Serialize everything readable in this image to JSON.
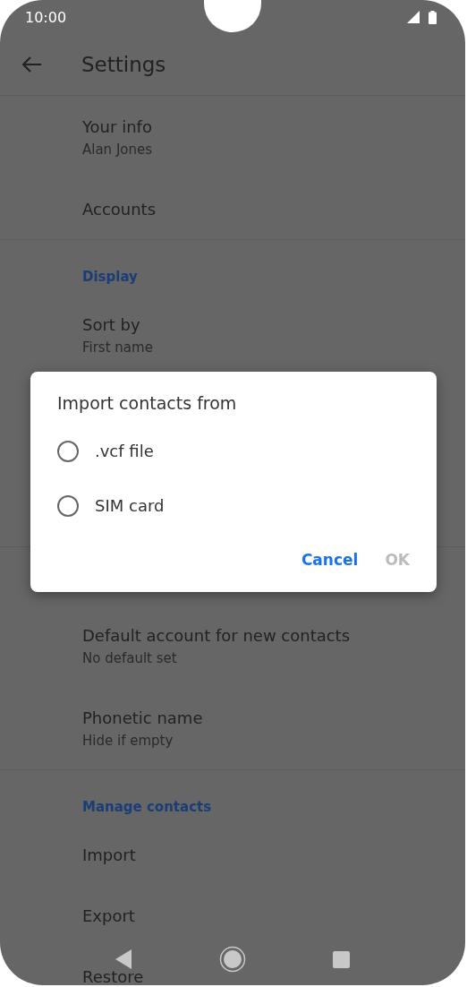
{
  "status_bar": {
    "time": "10:00"
  },
  "toolbar": {
    "title": "Settings"
  },
  "sections": [
    {
      "items": [
        {
          "title": "Your info",
          "subtitle": "Alan Jones"
        },
        {
          "title": "Accounts"
        }
      ]
    },
    {
      "header": "Display",
      "items": [
        {
          "title": "Sort by",
          "subtitle": "First name"
        }
      ]
    },
    {
      "items": [
        {
          "title": "Default account for new contacts",
          "subtitle": "No default set"
        },
        {
          "title": "Phonetic name",
          "subtitle": "Hide if empty"
        }
      ]
    },
    {
      "header": "Manage contacts",
      "items": [
        {
          "title": "Import"
        },
        {
          "title": "Export"
        },
        {
          "title": "Restore"
        }
      ]
    }
  ],
  "dialog": {
    "title": "Import contacts from",
    "options": [
      {
        "label": ".vcf file",
        "selected": false
      },
      {
        "label": "SIM card",
        "selected": false
      }
    ],
    "buttons": [
      {
        "label": "Cancel",
        "disabled": false
      },
      {
        "label": "OK",
        "disabled": true
      }
    ]
  }
}
